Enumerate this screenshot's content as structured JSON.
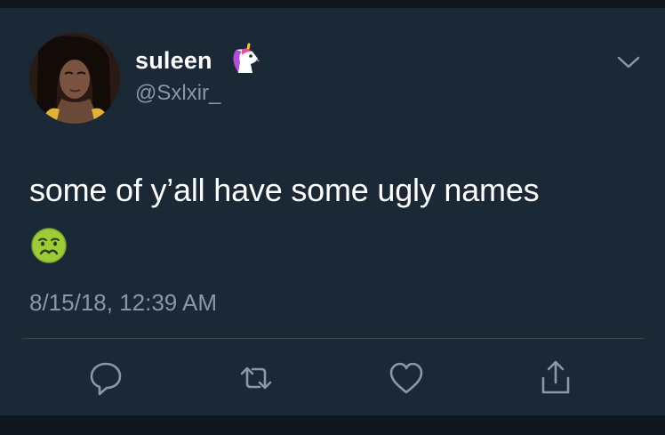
{
  "tweet": {
    "author": {
      "display_name": "suleen",
      "name_emoji": "unicorn-icon",
      "handle": "@Sxlxir_"
    },
    "text": "some of y’all have some ugly names",
    "text_emoji": "nauseated-face-icon",
    "timestamp": "8/15/18, 12:39 AM"
  },
  "actions": [
    "reply-icon",
    "retweet-icon",
    "like-icon",
    "share-icon"
  ],
  "colors": {
    "background": "#1b2836",
    "text": "#ffffff",
    "secondary_text": "#8899a6",
    "divider": "#38444d",
    "icon": "#8899a6"
  }
}
